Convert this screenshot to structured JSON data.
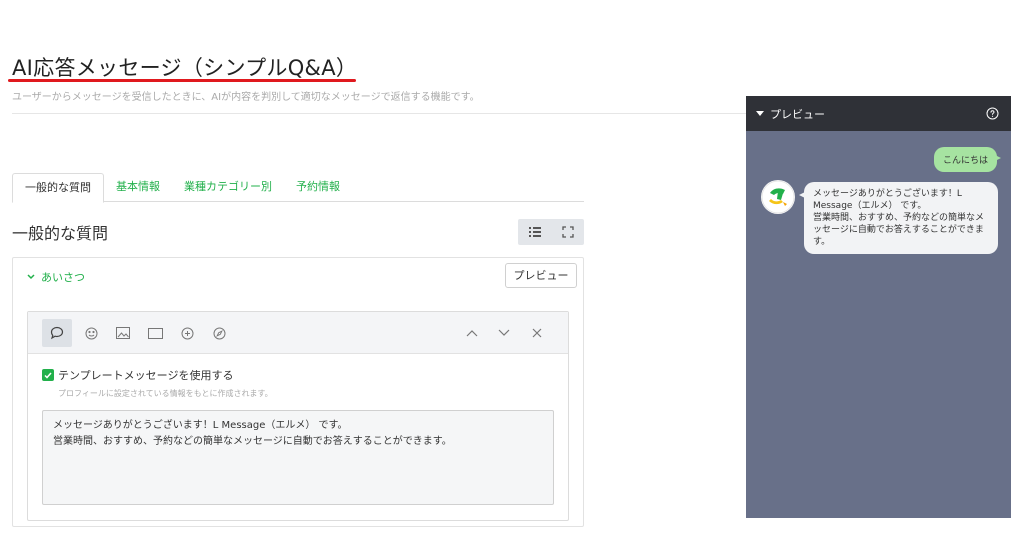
{
  "header": {
    "title": "AI応答メッセージ（シンプルQ&A）",
    "subtitle": "ユーザーからメッセージを受信したときに、AIが内容を判別して適切なメッセージで返信する機能です。"
  },
  "tabs": [
    {
      "label": "一般的な質問",
      "active": true
    },
    {
      "label": "基本情報",
      "active": false
    },
    {
      "label": "業種カテゴリー別",
      "active": false
    },
    {
      "label": "予約情報",
      "active": false
    }
  ],
  "section": {
    "title": "一般的な質問"
  },
  "accordion": {
    "label": "あいさつ",
    "preview_button": "プレビュー"
  },
  "editor": {
    "checkbox_label": "テンプレートメッセージを使用する",
    "help_text": "プロフィールに設定されている情報をもとに作成されます。",
    "message": "メッセージありがとうございます！L Message（エルメ） です。\n営業時間、おすすめ、予約などの簡単なメッセージに自動でお答えすることができます。"
  },
  "preview": {
    "title": "プレビュー",
    "user_message": "こんにちは",
    "bot_message": "メッセージありがとうございます！L Message（エルメ） です。\n営業時間、おすすめ、予約などの簡単なメッセージに自動でお答えすることができます。"
  },
  "colors": {
    "accent": "#22b04b",
    "title_underline": "#e0191e",
    "preview_bg": "#687089",
    "preview_header": "#2f3137",
    "user_bubble": "#a6e3a1"
  }
}
